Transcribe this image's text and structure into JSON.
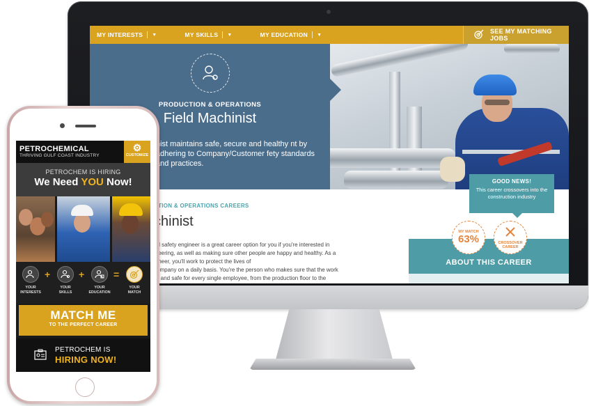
{
  "desktop": {
    "nav": {
      "items": [
        {
          "label": "MY INTERESTS"
        },
        {
          "label": "MY SKILLS"
        },
        {
          "label": "MY EDUCATION"
        }
      ],
      "cta_label": "SEE MY MATCHING JOBS"
    },
    "hero": {
      "category": "PRODUCTION & OPERATIONS",
      "title": "Field Machinist",
      "description": "nist maintains safe, secure and healthy nt by adhering to Company/Customer fety standards and practices."
    },
    "careers": {
      "label": "CTION & OPERATIONS CAREERS",
      "title": "chinist",
      "body_lines": [
        "nd safety engineer is a great career option for you if you're interested in",
        "ineering, as well as making sure other people are happy and healthy. As a",
        "gineer, you'll work to protect the lives of",
        "company on a daily basis. You're the person who makes sure that the work",
        "lly and safe for every single employee, from the production floor to the"
      ]
    },
    "good_news": {
      "title": "GOOD NEWS!",
      "text": "This career crossovers into the construction industry"
    },
    "match_badge": {
      "label": "MY MATCH",
      "value": "63%"
    },
    "crossover_badge": {
      "label": "CROSSOVER CAREER"
    },
    "about_label": "ABOUT THIS CAREER"
  },
  "phone": {
    "brand": "PETROCHEMICAL",
    "tagline": "THRIVING GULF COAST INDUSTRY",
    "customize_label": "CUSTOMIZE",
    "hiring_text": "PETROCHEM IS HIRING",
    "need_pre": "We Need ",
    "need_you": "YOU",
    "need_post": " Now!",
    "steps": [
      {
        "label": "YOUR INTERESTS"
      },
      {
        "label": "YOUR SKILLS"
      },
      {
        "label": "YOUR EDUCATION"
      },
      {
        "label": "YOUR MATCH"
      }
    ],
    "operators": [
      "+",
      "+",
      "="
    ],
    "match_title": "MATCH ME",
    "match_sub": "TO THE PERFECT CAREER",
    "bottom_line1": "PETROCHEM IS",
    "bottom_line2": "HIRING NOW!"
  },
  "colors": {
    "gold": "#d9a21f",
    "slate_blue": "#4a6d8c",
    "teal": "#4e9ca6",
    "orange": "#e4853d"
  }
}
